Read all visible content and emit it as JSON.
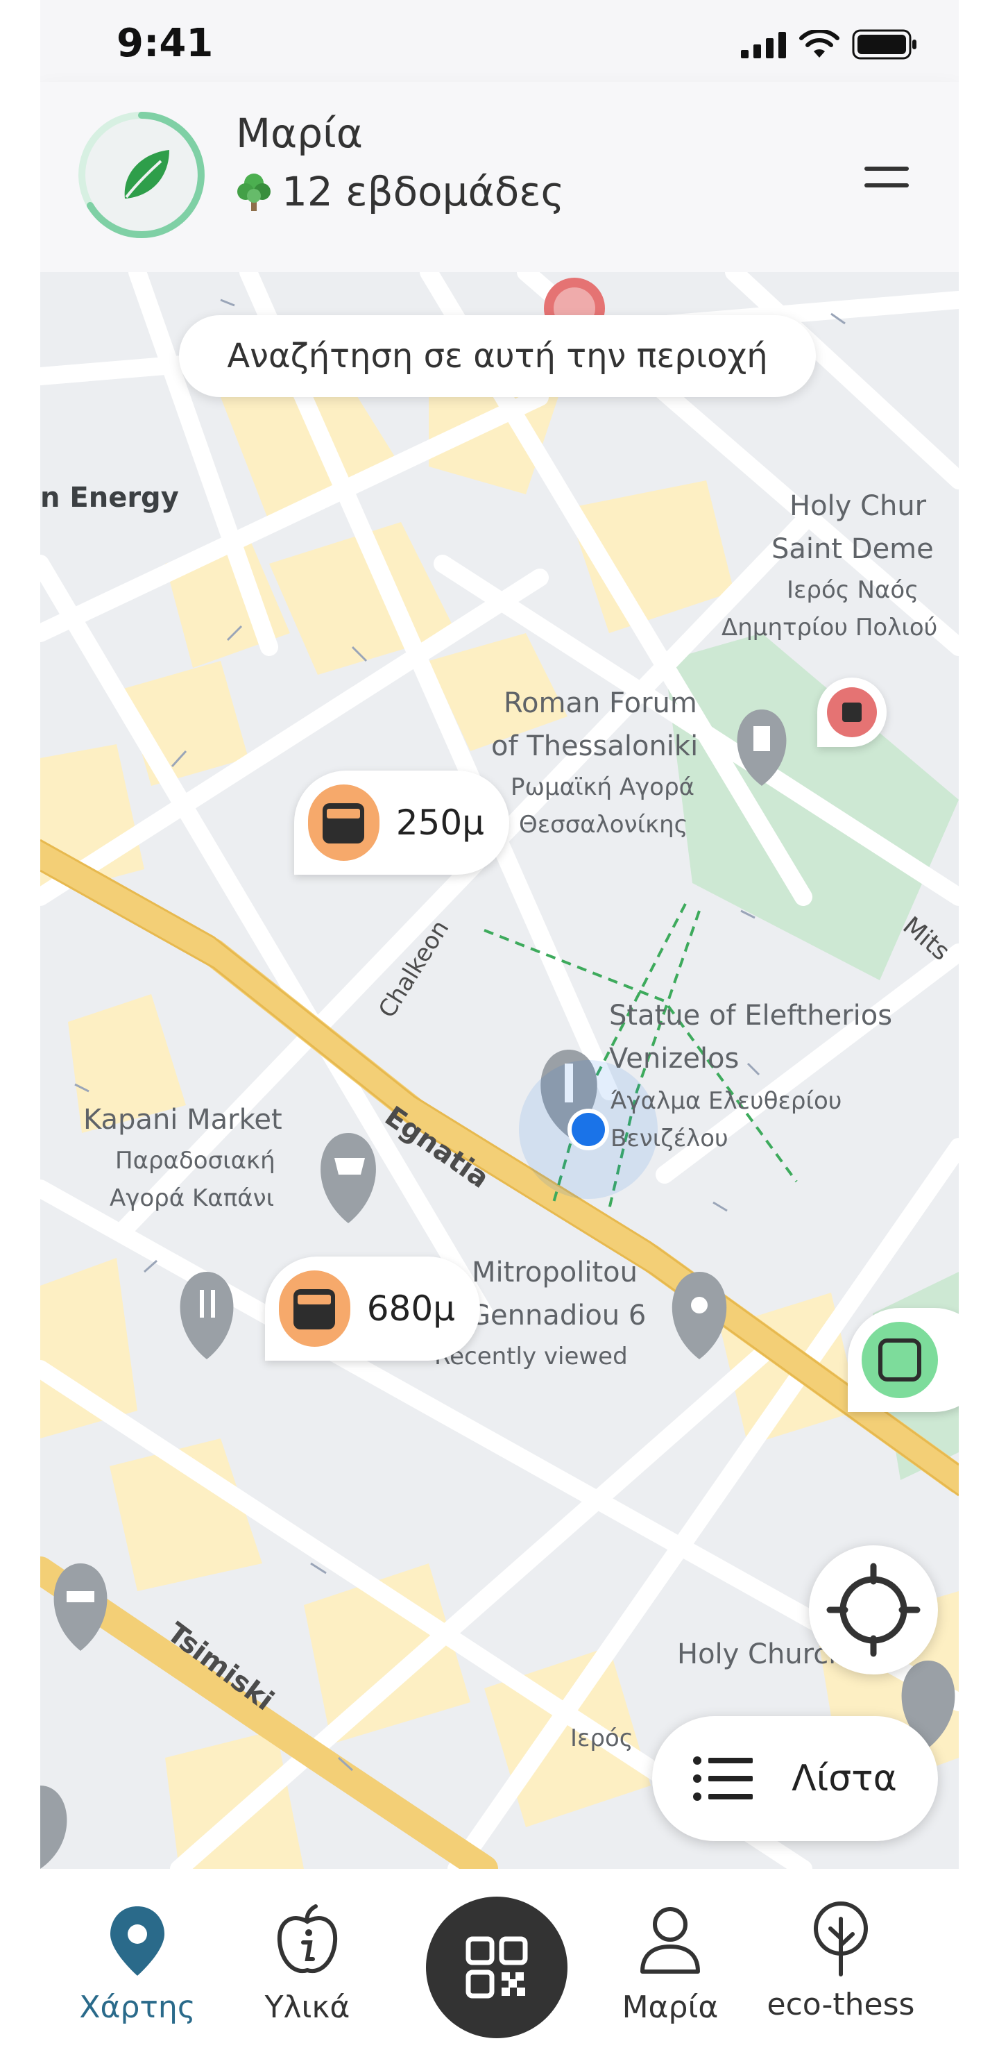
{
  "status_bar": {
    "time": "9:41"
  },
  "header": {
    "user_name": "Μαρία",
    "streak_text": "12 εβδομάδες"
  },
  "map": {
    "search_area_label": "Αναζήτηση σε αυτή την περιοχή",
    "labels": {
      "energy": "n Energy",
      "holy_church_en_1": "Holy Chur",
      "holy_church_en_2": "Saint Deme",
      "holy_church_gr_1": "Ιερός Ναός",
      "holy_church_gr_2": "Δημητρίου Πολιού",
      "roman_forum_1": "Roman Forum",
      "roman_forum_2": "of Thessaloniki",
      "roman_forum_gr_1": "Ρωμαϊκή Αγορά",
      "roman_forum_gr_2": "Θεσσαλονίκης",
      "statue_1": "Statue of Eleftherios",
      "statue_2": "Venizelos",
      "statue_gr_1": "Άγαλμα Ελευθερίου",
      "statue_gr_2": "Βενιζέλου",
      "kapani_1": "Kapani Market",
      "kapani_2": "Παραδοσιακή",
      "kapani_3": "Αγορά Καπάνι",
      "mitropolitou_1": "Mitropolitou",
      "mitropolitou_2": "Gennadiou 6",
      "recently_viewed": "Recently viewed",
      "holy_church_bottom": "Holy Church of",
      "ieros": "Ιερός"
    },
    "streets": {
      "egnatia": "Egnatia",
      "chalkeon": "Chalkeon",
      "tsimiski": "Tsimiski",
      "mits": "Mits"
    },
    "markers": [
      {
        "distance": "250μ",
        "color": "#f6a96b"
      },
      {
        "distance": "680μ",
        "color": "#f6a96b"
      }
    ],
    "side_markers": {
      "red": "#e57373",
      "green": "#7ddc9b"
    },
    "list_button_label": "Λίστα"
  },
  "bottom_nav": {
    "items": [
      {
        "label": "Χάρτης",
        "icon": "map-pin-icon",
        "active": true
      },
      {
        "label": "Υλικά",
        "icon": "apple-info-icon",
        "active": false
      },
      {
        "label": "Μαρία",
        "icon": "user-icon",
        "active": false
      },
      {
        "label": "eco-thess",
        "icon": "tree-icon",
        "active": false
      }
    ],
    "center_icon": "qr-code-icon"
  },
  "colors": {
    "accent": "#2a6a8a",
    "leaf_green": "#2e9e4a",
    "ring_green": "#7fd0a5",
    "road_yellow": "#f3cf76",
    "block_yellow": "#fdefc3",
    "park_green": "#cde8d3",
    "user_blue": "#1a73e8"
  }
}
